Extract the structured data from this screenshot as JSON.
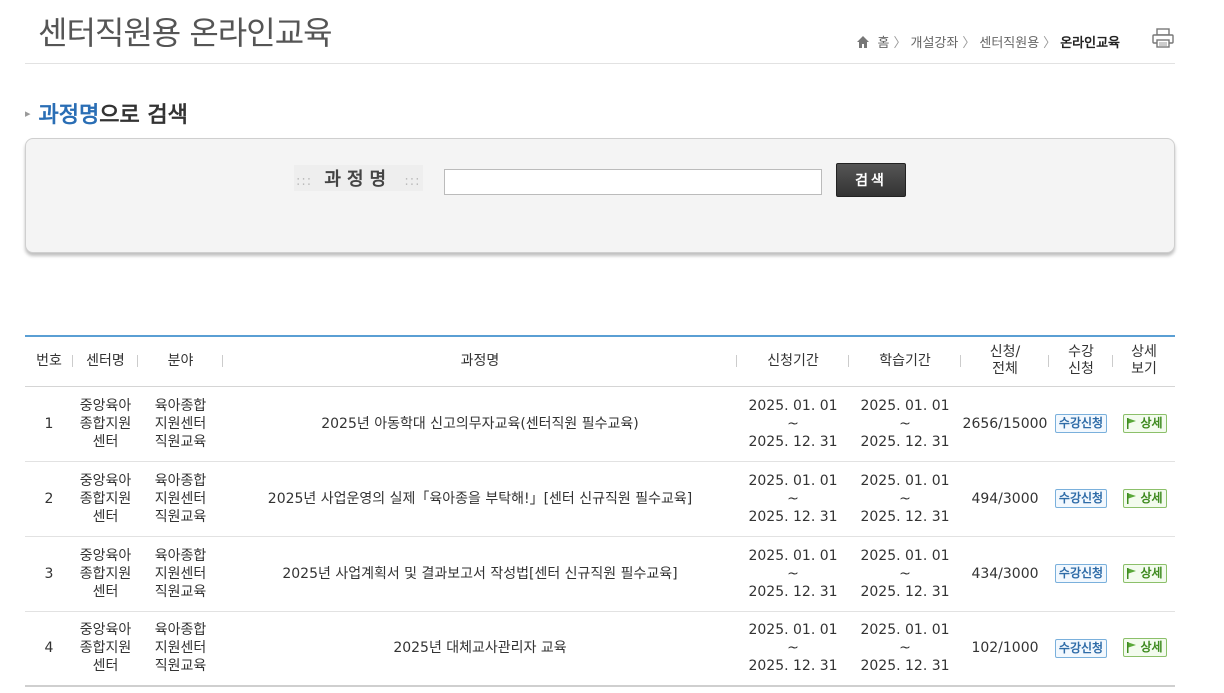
{
  "header": {
    "title": "센터직원용 온라인교육",
    "breadcrumb": [
      "홈",
      "개설강좌",
      "센터직원용",
      "온라인교육"
    ],
    "breadcrumb_sep": "〉"
  },
  "search": {
    "heading_accent": "과정명",
    "heading_rest": "으로 검색",
    "label_dots_left": ":::",
    "label": "과정명",
    "label_dots_right": ":::",
    "input_value": "",
    "button_label": "검색"
  },
  "table": {
    "columns": {
      "no": "번호",
      "center": "센터명",
      "field": "분야",
      "title": "과정명",
      "apply_period": "신청기간",
      "study_period": "학습기간",
      "count_1": "신청/",
      "count_2": "전체",
      "enroll_1": "수강",
      "enroll_2": "신청",
      "detail_1": "상세",
      "detail_2": "보기"
    },
    "rows": [
      {
        "no": "1",
        "center": [
          "중앙육아",
          "종합지원",
          "센터"
        ],
        "field": [
          "육아종합",
          "지원센터",
          "직원교육"
        ],
        "title": "2025년 아동학대 신고의무자교육(센터직원 필수교육)",
        "apply": [
          "2025. 01. 01",
          "~",
          "2025. 12. 31"
        ],
        "study": [
          "2025. 01. 01",
          "~",
          "2025. 12. 31"
        ],
        "count": "2656/15000",
        "apply_btn": "수강신청",
        "detail_btn": "상세"
      },
      {
        "no": "2",
        "center": [
          "중앙육아",
          "종합지원",
          "센터"
        ],
        "field": [
          "육아종합",
          "지원센터",
          "직원교육"
        ],
        "title": "2025년 사업운영의 실제「육아종을 부탁해!」[센터 신규직원 필수교육]",
        "apply": [
          "2025. 01. 01",
          "~",
          "2025. 12. 31"
        ],
        "study": [
          "2025. 01. 01",
          "~",
          "2025. 12. 31"
        ],
        "count": "494/3000",
        "apply_btn": "수강신청",
        "detail_btn": "상세"
      },
      {
        "no": "3",
        "center": [
          "중앙육아",
          "종합지원",
          "센터"
        ],
        "field": [
          "육아종합",
          "지원센터",
          "직원교육"
        ],
        "title": "2025년 사업계획서 및 결과보고서 작성법[센터 신규직원 필수교육]",
        "apply": [
          "2025. 01. 01",
          "~",
          "2025. 12. 31"
        ],
        "study": [
          "2025. 01. 01",
          "~",
          "2025. 12. 31"
        ],
        "count": "434/3000",
        "apply_btn": "수강신청",
        "detail_btn": "상세"
      },
      {
        "no": "4",
        "center": [
          "중앙육아",
          "종합지원",
          "센터"
        ],
        "field": [
          "육아종합",
          "지원센터",
          "직원교육"
        ],
        "title": "2025년 대체교사관리자 교육",
        "apply": [
          "2025. 01. 01",
          "~",
          "2025. 12. 31"
        ],
        "study": [
          "2025. 01. 01",
          "~",
          "2025. 12. 31"
        ],
        "count": "102/1000",
        "apply_btn": "수강신청",
        "detail_btn": "상세"
      }
    ]
  },
  "icons": {
    "home": "home-icon",
    "print": "print-icon",
    "flag": "flag-icon"
  },
  "colors": {
    "accent_blue": "#2a6eb5",
    "table_top_border": "#5a9fd4",
    "apply_btn": "#2f6ca8",
    "detail_btn": "#3e8a1f"
  }
}
